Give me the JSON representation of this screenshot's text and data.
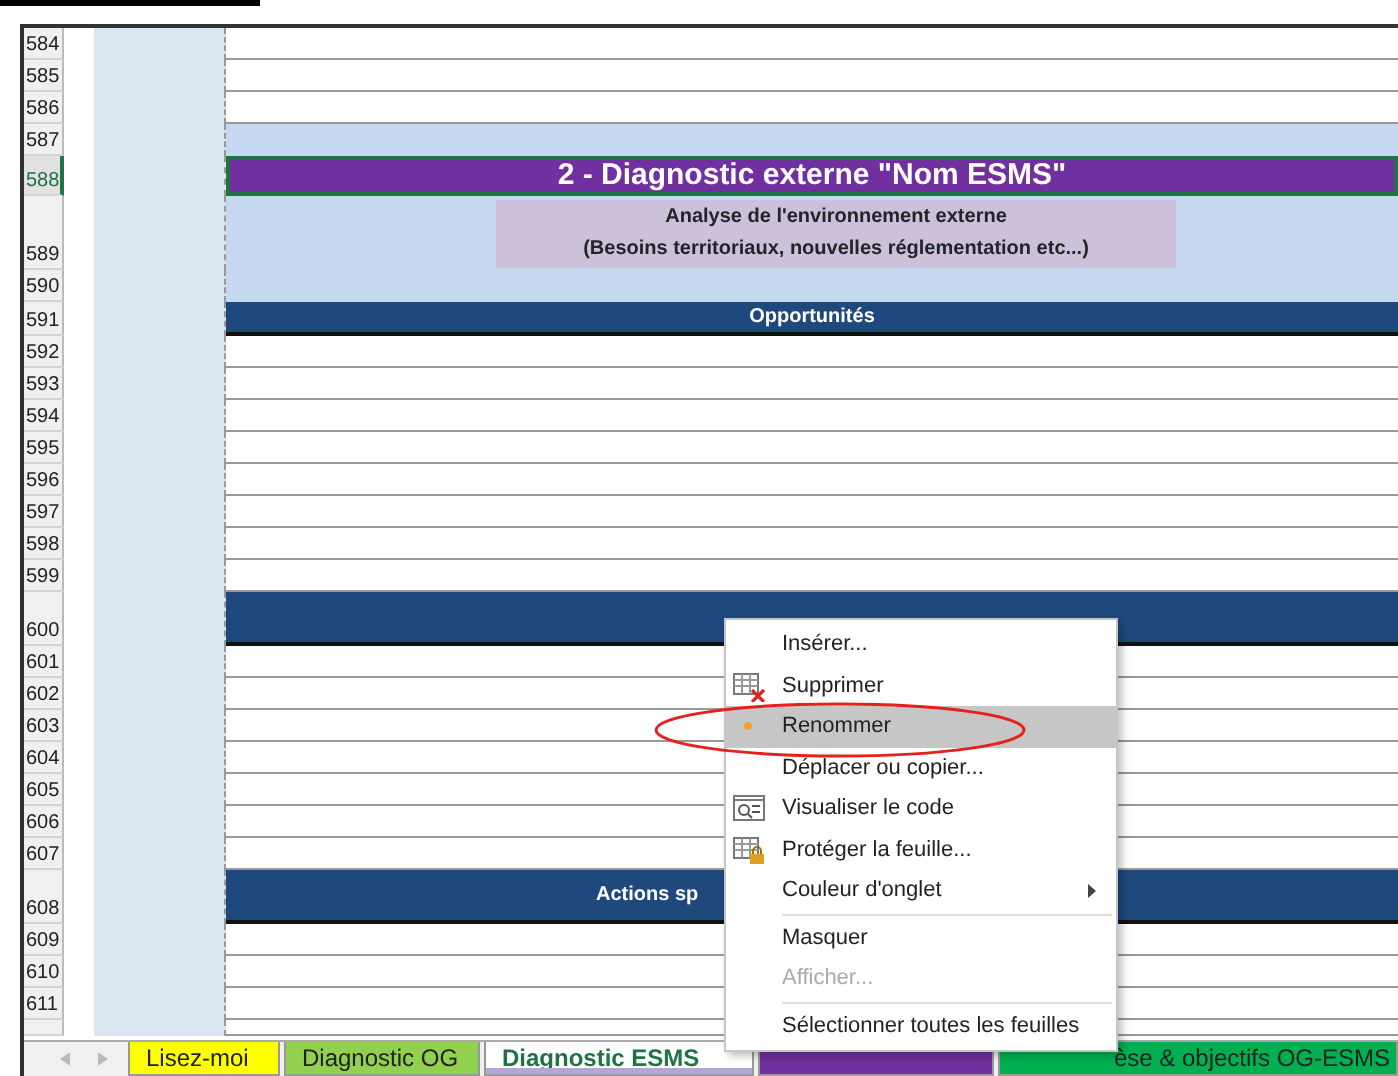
{
  "sheet": {
    "rows": [
      {
        "number": "584",
        "kind": "blank",
        "selected": false
      },
      {
        "number": "585",
        "kind": "blank",
        "selected": false
      },
      {
        "number": "586",
        "kind": "blank",
        "selected": false
      },
      {
        "number": "587",
        "kind": "band",
        "selected": false
      },
      {
        "number": "588",
        "kind": "title",
        "selected": true,
        "text": "2 - Diagnostic externe \"Nom ESMS\""
      },
      {
        "number": "589",
        "kind": "subtitle",
        "selected": false,
        "lines": [
          "Analyse de l'environnement externe",
          "(Besoins territoriaux, nouvelles réglementation etc...)"
        ]
      },
      {
        "number": "590",
        "kind": "band",
        "selected": false
      },
      {
        "number": "591",
        "kind": "section",
        "selected": false,
        "text": "Opportunités"
      },
      {
        "number": "592",
        "kind": "blank",
        "selected": false
      },
      {
        "number": "593",
        "kind": "blank",
        "selected": false
      },
      {
        "number": "594",
        "kind": "blank",
        "selected": false
      },
      {
        "number": "595",
        "kind": "blank",
        "selected": false
      },
      {
        "number": "596",
        "kind": "blank",
        "selected": false
      },
      {
        "number": "597",
        "kind": "blank",
        "selected": false
      },
      {
        "number": "598",
        "kind": "blank",
        "selected": false
      },
      {
        "number": "599",
        "kind": "blank",
        "selected": false
      },
      {
        "number": "600",
        "kind": "section-tall",
        "selected": false
      },
      {
        "number": "601",
        "kind": "blank",
        "selected": false
      },
      {
        "number": "602",
        "kind": "blank",
        "selected": false
      },
      {
        "number": "603",
        "kind": "blank",
        "selected": false
      },
      {
        "number": "604",
        "kind": "blank",
        "selected": false
      },
      {
        "number": "605",
        "kind": "blank",
        "selected": false
      },
      {
        "number": "606",
        "kind": "blank",
        "selected": false
      },
      {
        "number": "607",
        "kind": "blank",
        "selected": false
      },
      {
        "number": "608",
        "kind": "section-tall",
        "selected": false,
        "text": "Actions sp"
      },
      {
        "number": "609",
        "kind": "blank",
        "selected": false
      },
      {
        "number": "610",
        "kind": "blank",
        "selected": false
      },
      {
        "number": "611",
        "kind": "blank",
        "selected": false
      },
      {
        "kind": "partial",
        "selected": false
      }
    ]
  },
  "sheet_tabs": [
    {
      "label": "Lisez-moi",
      "color": "#ffff00",
      "selected": false
    },
    {
      "label": "Diagnostic OG",
      "color": "#92d050",
      "selected": false
    },
    {
      "label": "Diagnostic ESMS",
      "color": "#b4a7d6",
      "selected": true
    },
    {
      "color": "#7030a0",
      "selected": false
    },
    {
      "label": "èse & objectifs OG-ESMS",
      "color": "#00b050",
      "selected": false
    }
  ],
  "context_menu": {
    "items": [
      {
        "label": "Insérer...",
        "kind": "item",
        "disabled": false,
        "selected": false
      },
      {
        "label": "Supprimer",
        "kind": "delete",
        "disabled": false,
        "selected": false
      },
      {
        "label": "Renommer",
        "kind": "item",
        "disabled": false,
        "selected": true
      },
      {
        "label": "Déplacer ou copier...",
        "kind": "item",
        "disabled": false,
        "selected": false
      },
      {
        "label": "Visualiser le code",
        "kind": "code",
        "disabled": false,
        "selected": false
      },
      {
        "label": "Protéger la feuille...",
        "kind": "protect",
        "disabled": false,
        "selected": false
      },
      {
        "label": "Couleur d'onglet",
        "kind": "submenu",
        "disabled": false,
        "selected": false
      },
      {
        "kind": "separator"
      },
      {
        "label": "Masquer",
        "kind": "item",
        "disabled": false,
        "selected": false
      },
      {
        "label": "Afficher...",
        "kind": "item",
        "disabled": true,
        "selected": false
      },
      {
        "kind": "separator"
      },
      {
        "label": "Sélectionner toutes les feuilles",
        "kind": "item",
        "disabled": false,
        "selected": false
      }
    ]
  }
}
